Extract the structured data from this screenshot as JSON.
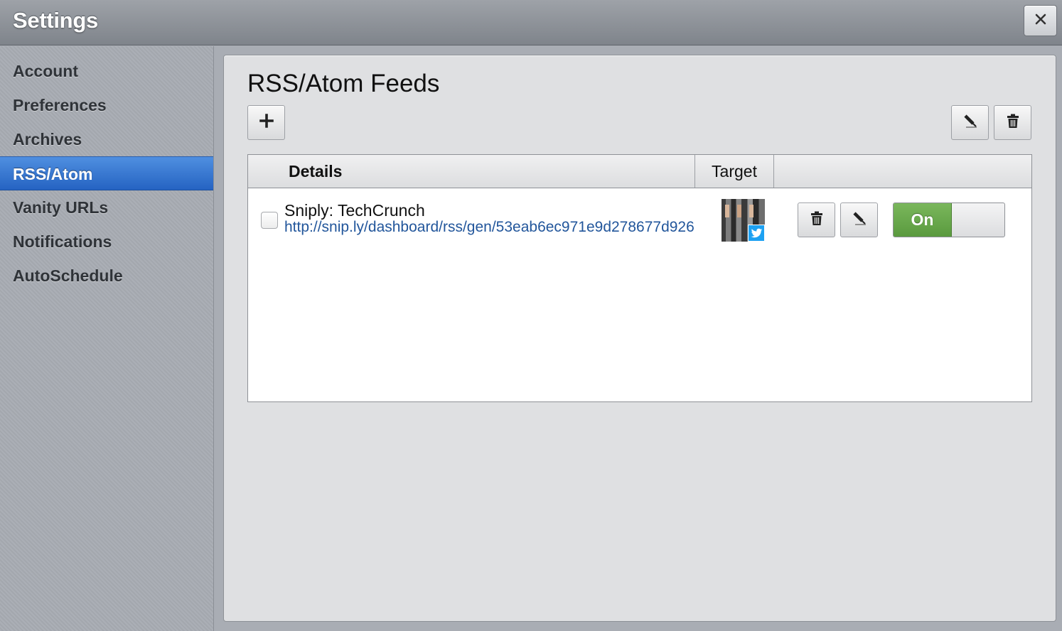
{
  "window": {
    "title": "Settings",
    "close_icon": "close-icon"
  },
  "sidebar": {
    "items": [
      {
        "label": "Account",
        "active": false
      },
      {
        "label": "Preferences",
        "active": false
      },
      {
        "label": "Archives",
        "active": false
      },
      {
        "label": "RSS/Atom",
        "active": true
      },
      {
        "label": "Vanity URLs",
        "active": false
      },
      {
        "label": "Notifications",
        "active": false
      },
      {
        "label": "AutoSchedule",
        "active": false
      }
    ],
    "active_color": "#2f6fcf"
  },
  "main": {
    "title": "RSS/Atom Feeds",
    "toolbar": {
      "add_icon": "plus-icon",
      "edit_icon": "pencil-icon",
      "delete_icon": "trash-icon"
    },
    "table": {
      "columns": [
        "Details",
        "Target",
        ""
      ],
      "rows": [
        {
          "checked": false,
          "name": "Sniply: TechCrunch",
          "url": "http://snip.ly/dashboard/rss/gen/53eab6ec971e9d278677d926",
          "target_icon": "twitter-icon",
          "toggle_label": "On",
          "enabled": true
        }
      ]
    },
    "toggle_on_color": "#6aaa4c",
    "link_color": "#22569b"
  }
}
